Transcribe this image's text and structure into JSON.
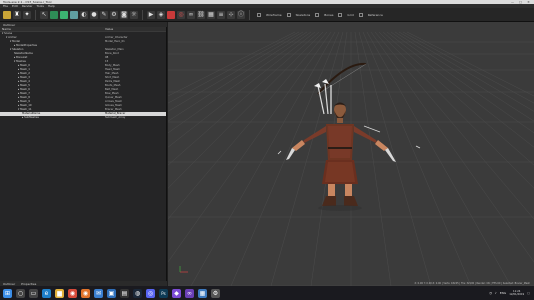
{
  "window": {
    "title": "Tools.exe 2.1 - CS7_Scene.r_Tool",
    "controls": [
      "—",
      "□",
      "✕"
    ]
  },
  "menubar": {
    "items": [
      "File",
      "Edit",
      "Render",
      "Tools",
      "Help"
    ]
  },
  "toolbar": {
    "texts": [
      "Wireframe",
      "Skeletons",
      "Bones",
      "Grid",
      "Reference"
    ]
  },
  "subbar": {
    "label": "Outliner"
  },
  "tree": {
    "columns": [
      "Name",
      "Value"
    ],
    "rows": [
      {
        "name": "▾ Scene",
        "value": "",
        "indent": 0,
        "selected": false
      },
      {
        "name": "▾ Archer",
        "value": "Archer_Character",
        "indent": 1,
        "selected": false
      },
      {
        "name": "▾ Model",
        "value": "Model_Hero_01",
        "indent": 2,
        "selected": false
      },
      {
        "name": "▸ ModelProperties",
        "value": "",
        "indent": 3,
        "selected": false
      },
      {
        "name": "▾ Skeleton",
        "value": "Skeleton_Main",
        "indent": 2,
        "selected": false
      },
      {
        "name": "SkeletonName",
        "value": "Bone_Root",
        "indent": 3,
        "selected": false
      },
      {
        "name": "▸ BoneList",
        "value": "98",
        "indent": 3,
        "selected": false
      },
      {
        "name": "▾ Meshes",
        "value": "15",
        "indent": 3,
        "selected": false
      },
      {
        "name": "▸ Mesh_0",
        "value": "Body_Mesh",
        "indent": 4,
        "selected": false
      },
      {
        "name": "▸ Mesh_1",
        "value": "Head_Mesh",
        "indent": 4,
        "selected": false
      },
      {
        "name": "▸ Mesh_2",
        "value": "Hair_Mesh",
        "indent": 4,
        "selected": false
      },
      {
        "name": "▸ Mesh_3",
        "value": "Shirt_Mesh",
        "indent": 4,
        "selected": false
      },
      {
        "name": "▸ Mesh_4",
        "value": "Pants_Mesh",
        "indent": 4,
        "selected": false
      },
      {
        "name": "▸ Mesh_5",
        "value": "Boots_Mesh",
        "indent": 4,
        "selected": false
      },
      {
        "name": "▸ Mesh_6",
        "value": "Belt_Mesh",
        "indent": 4,
        "selected": false
      },
      {
        "name": "▸ Mesh_7",
        "value": "Bow_Mesh",
        "indent": 4,
        "selected": false
      },
      {
        "name": "▸ Mesh_8",
        "value": "Quiver_Mesh",
        "indent": 4,
        "selected": false
      },
      {
        "name": "▸ Mesh_9",
        "value": "Arrows_Mesh",
        "indent": 4,
        "selected": false
      },
      {
        "name": "▸ Mesh_10",
        "value": "Gloves_Mesh",
        "indent": 4,
        "selected": false
      },
      {
        "name": "▾ Mesh_11",
        "value": "Bracer_Mesh",
        "indent": 4,
        "selected": false
      },
      {
        "name": "MaterialName",
        "value": "Material_Bracer",
        "indent": 5,
        "selected": true
      },
      {
        "name": "▸ SubMeshes",
        "value": "Submesh_Array",
        "indent": 5,
        "selected": false
      }
    ]
  },
  "panel_footer": {
    "tabs": [
      "Outliner",
      "Properties"
    ]
  },
  "viewport": {
    "colors": {
      "background": "#3a3a3a",
      "grid": "#4a4a4a",
      "skin": "#c98660",
      "cloth": "#7a3b2a",
      "dark": "#2b1d16",
      "metal": "#d8d8d8"
    }
  },
  "status": {
    "text": "X: 0.00 Y: 0.00 Z: 0.00 | Verts: 18245 | Tris: 32100 | Render: OK | FPS 60 | Selected: Bracer_Mesh"
  },
  "taskbar": {
    "apps": [
      {
        "icon": "windows-icon",
        "glyph": "⊞",
        "color": "#3b8ee8"
      },
      {
        "icon": "search-icon",
        "glyph": "○",
        "color": "#444"
      },
      {
        "icon": "task-view-icon",
        "glyph": "▭",
        "color": "#444"
      },
      {
        "icon": "edge-icon",
        "glyph": "e",
        "color": "#1e7fc9"
      },
      {
        "icon": "explorer-icon",
        "glyph": "▆",
        "color": "#e1b03a"
      },
      {
        "icon": "chrome-icon",
        "glyph": "◉",
        "color": "#d64b3a"
      },
      {
        "icon": "firefox-icon",
        "glyph": "◉",
        "color": "#e2742a"
      },
      {
        "icon": "mail-icon",
        "glyph": "✉",
        "color": "#3a7fd0"
      },
      {
        "icon": "store-icon",
        "glyph": "▣",
        "color": "#2f6fb9"
      },
      {
        "icon": "terminal-icon",
        "glyph": "▤",
        "color": "#333"
      },
      {
        "icon": "steam-icon",
        "glyph": "◍",
        "color": "#1b2838"
      },
      {
        "icon": "discord-icon",
        "glyph": "◎",
        "color": "#5865f2"
      },
      {
        "icon": "photoshop-icon",
        "glyph": "Ps",
        "color": "#0e3b56"
      },
      {
        "icon": "tool-icon",
        "glyph": "◆",
        "color": "#7c4bd6"
      },
      {
        "icon": "vs-icon",
        "glyph": "∞",
        "color": "#6a3fb5"
      },
      {
        "icon": "notepad-icon",
        "glyph": "▦",
        "color": "#3d7abf"
      },
      {
        "icon": "settings-icon",
        "glyph": "⚙",
        "color": "#555"
      }
    ],
    "tray": {
      "lang": "ENG",
      "time": "11:24",
      "date": "12/01/2019"
    }
  }
}
